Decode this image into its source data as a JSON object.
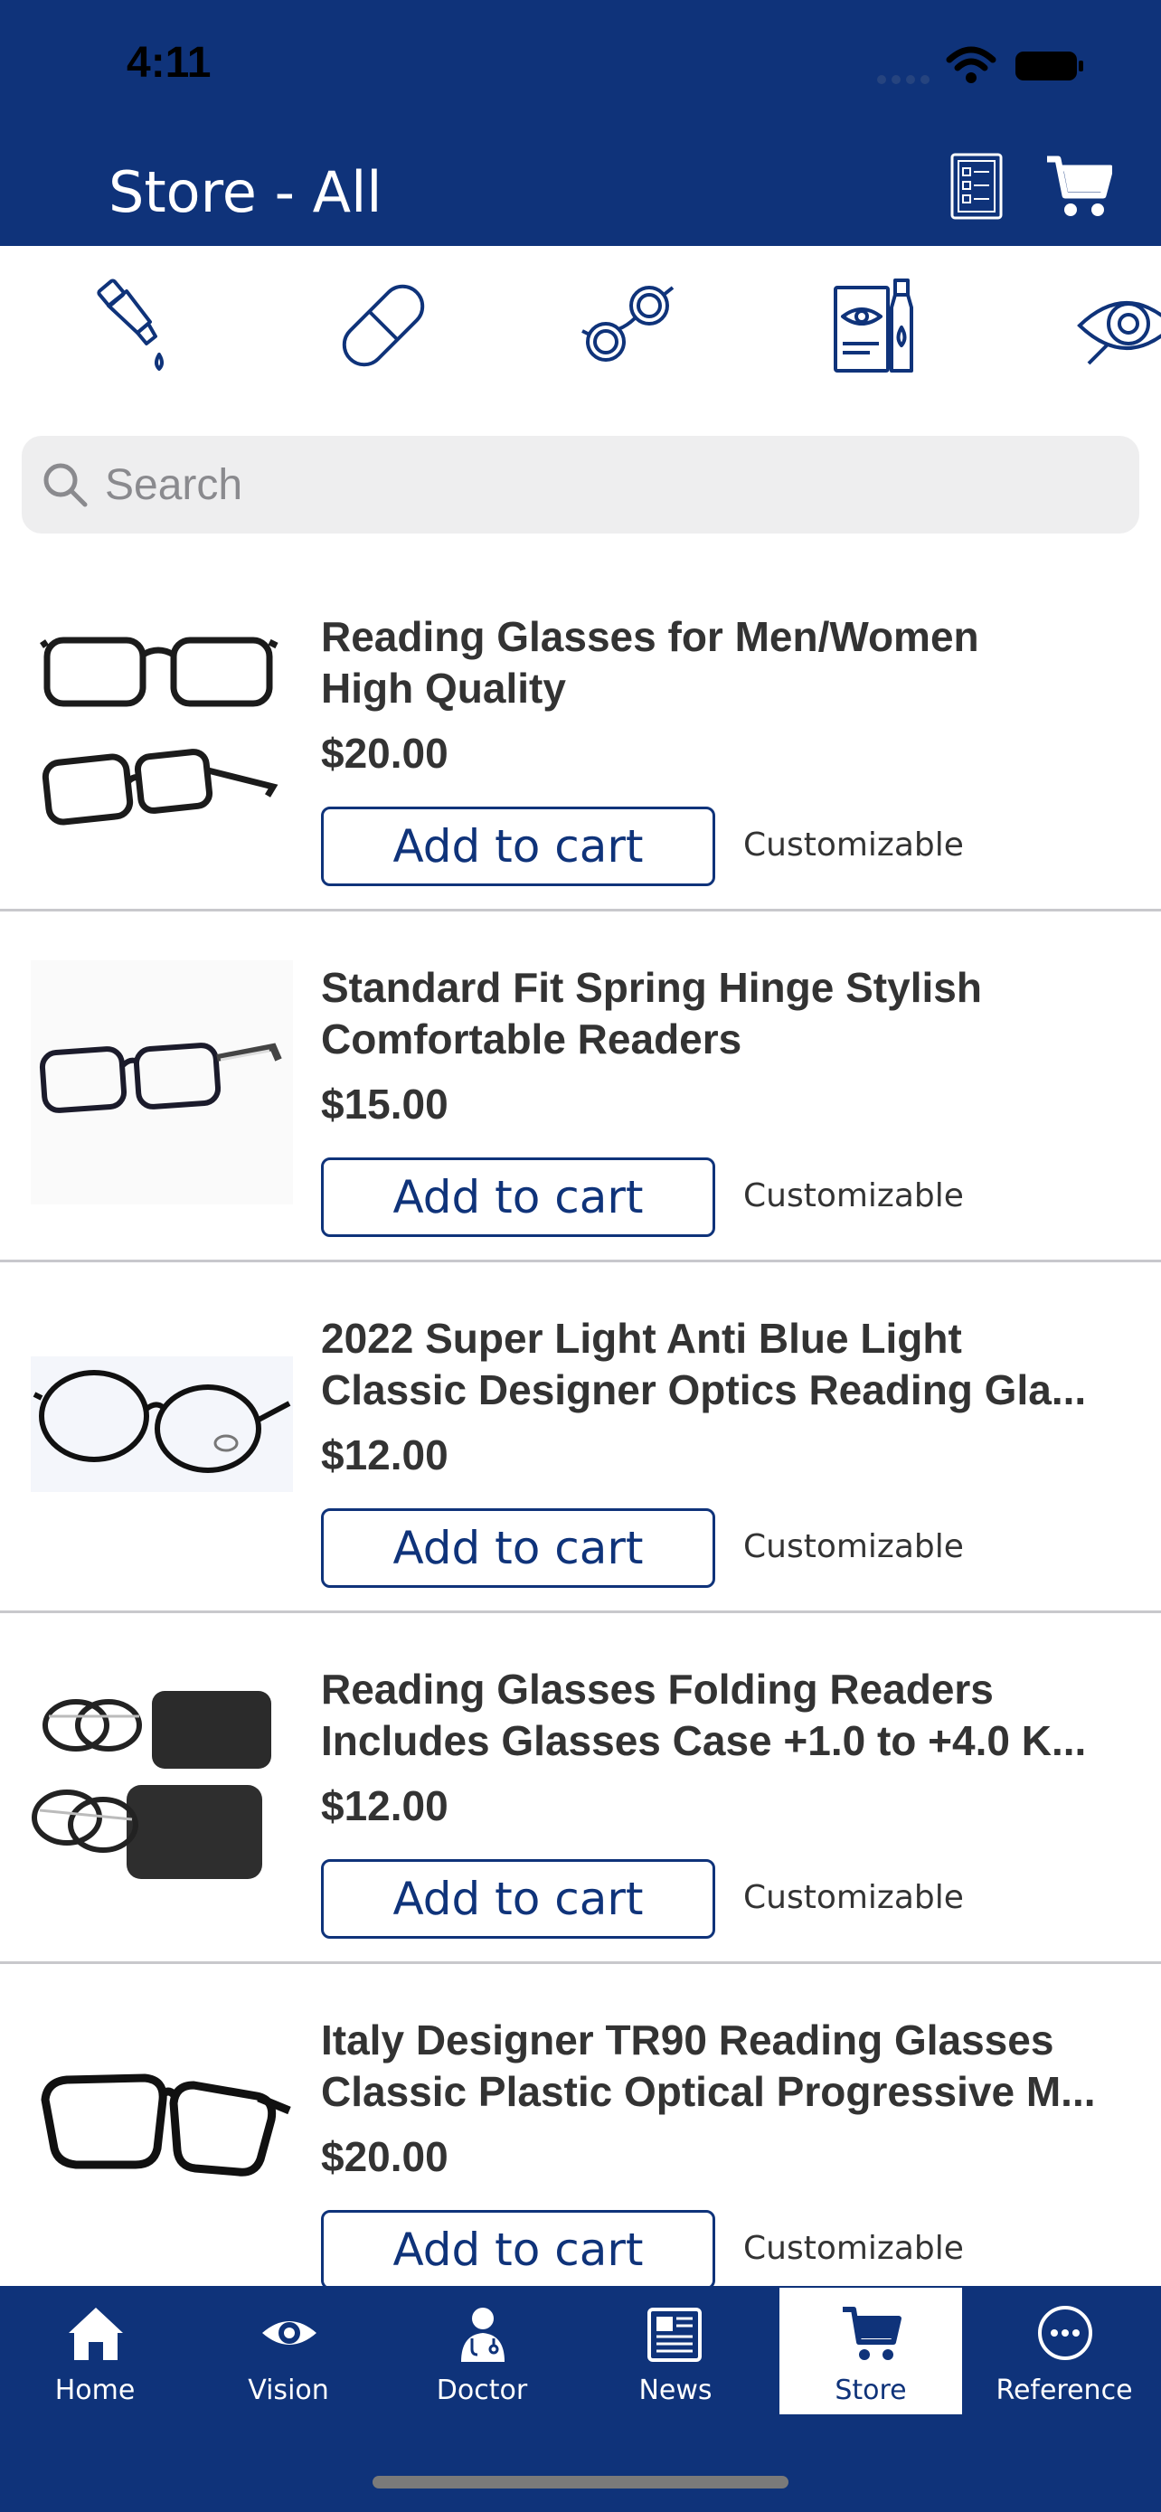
{
  "status": {
    "time": "4:11"
  },
  "header": {
    "title": "Store - All"
  },
  "search": {
    "placeholder": "Search"
  },
  "colors": {
    "brand": "#0f337a",
    "text": "#333333",
    "separator": "#c8c8cc",
    "search_bg": "#eeeeef"
  },
  "categories": [
    "eye-drops-icon",
    "pill-capsule-icon",
    "glasses-icon",
    "eye-care-products-icon",
    "eye-exam-icon"
  ],
  "products": [
    {
      "name_line1": "Reading Glasses for Men/Women",
      "name_line2": "High Quality",
      "price": "$20.00",
      "button": "Add to cart",
      "tag": "Customizable"
    },
    {
      "name_line1": "Standard Fit Spring Hinge Stylish",
      "name_line2": "Comfortable Readers",
      "price": "$15.00",
      "button": "Add to cart",
      "tag": "Customizable"
    },
    {
      "name_line1": "2022 Super Light Anti Blue Light",
      "name_line2": "Classic Designer Optics Reading Gla...",
      "price": "$12.00",
      "button": "Add to cart",
      "tag": "Customizable"
    },
    {
      "name_line1": "Reading Glasses Folding Readers",
      "name_line2": "Includes Glasses Case +1.0 to +4.0 K...",
      "price": "$12.00",
      "button": "Add to cart",
      "tag": "Customizable"
    },
    {
      "name_line1": "Italy Designer TR90 Reading Glasses",
      "name_line2": "Classic Plastic Optical Progressive M...",
      "price": "$20.00",
      "button": "Add to cart",
      "tag": "Customizable"
    }
  ],
  "tabs": [
    {
      "label": "Home",
      "icon": "home-icon"
    },
    {
      "label": "Vision",
      "icon": "eye-icon"
    },
    {
      "label": "Doctor",
      "icon": "doctor-icon"
    },
    {
      "label": "News",
      "icon": "newspaper-icon"
    },
    {
      "label": "Store",
      "icon": "cart-icon",
      "active": true
    },
    {
      "label": "Reference",
      "icon": "more-icon"
    }
  ]
}
